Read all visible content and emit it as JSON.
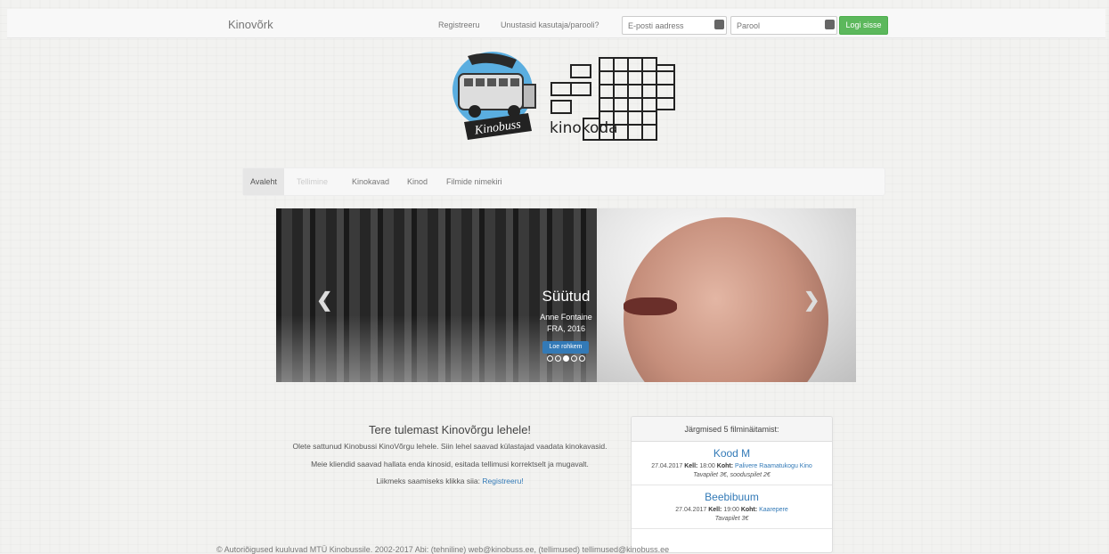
{
  "header": {
    "brand": "Kinovõrk",
    "register_link": "Registreeru",
    "forgot_link": "Unustasid kasutaja/parooli?",
    "email_placeholder": "E-posti aadress",
    "password_placeholder": "Parool",
    "login_button": "Logi sisse"
  },
  "logo": {
    "badge_text": "Kinobuss",
    "wordmark": "kinokoda"
  },
  "nav": {
    "items": [
      {
        "label": "Avaleht",
        "state": "active"
      },
      {
        "label": "Tellimine",
        "state": "disabled"
      },
      {
        "label": "Kinokavad",
        "state": "normal"
      },
      {
        "label": "Kinod",
        "state": "normal"
      },
      {
        "label": "Filmide nimekiri",
        "state": "normal"
      }
    ]
  },
  "carousel": {
    "title": "Süütud",
    "director": "Anne Fontaine",
    "country_year": "FRA, 2016",
    "button": "Loe rohkem",
    "slide_count": 5,
    "active_slide": 3
  },
  "welcome": {
    "title": "Tere tulemast Kinovõrgu lehele!",
    "line1": "Olete sattunud Kinobussi KinoVõrgu lehele. Siin lehel saavad külastajad vaadata kinokavasid.",
    "line2": "Meie kliendid saavad hallata enda kinosid, esitada tellimusi korrektselt ja mugavalt.",
    "line3_prefix": "Liikmeks saamiseks klikka siia:",
    "line3_link": "Registreeru!"
  },
  "upcoming": {
    "heading": "Järgmised 5 filminäitamist:",
    "time_label": "Kell:",
    "place_label": "Koht:",
    "items": [
      {
        "title": "Kood M",
        "date": "27.04.2017",
        "time": "18:00",
        "place": "Palivere Raamatukogu Kino",
        "price": "Tavapilet 3€, sooduspilet 2€"
      },
      {
        "title": "Beebibuum",
        "date": "27.04.2017",
        "time": "19:00",
        "place": "Kaarepere",
        "price": "Tavapilet 3€"
      }
    ]
  },
  "footer": {
    "text": "© Autoriõigused kuuluvad MTÜ Kinobussile. 2002-2017 Abi: (tehniline) web@kinobuss.ee, (tellimused) tellimused@kinobuss.ee"
  },
  "colors": {
    "login_green": "#5cb85c",
    "link_blue": "#337ab7",
    "logo_blue": "#5aaee0"
  }
}
